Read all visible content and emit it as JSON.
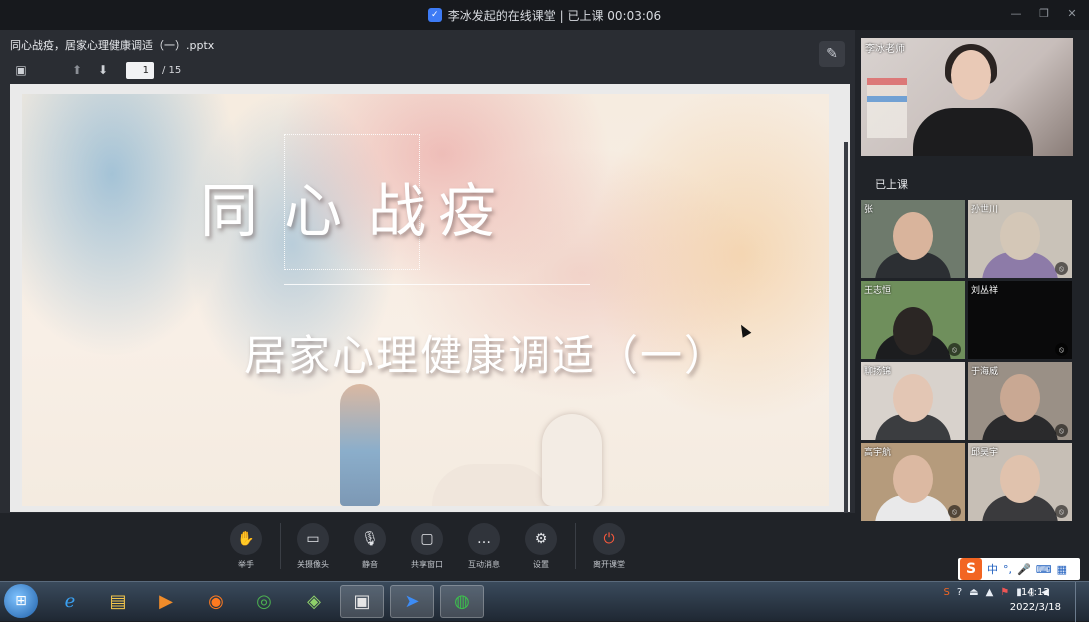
{
  "window": {
    "title": "李冰发起的在线课堂 | 已上课 00:03:06"
  },
  "document": {
    "filename": "同心战疫，居家心理健康调适（一）.pptx",
    "current_page": "1",
    "total_pages": "/ 15"
  },
  "slide": {
    "title_part1": "同",
    "title_part2": "心",
    "title_part3": "战疫",
    "subtitle": "居家心理健康调适（一）"
  },
  "controls": [
    {
      "label": "举手",
      "icon": "hand-icon"
    },
    {
      "label": "关摄像头",
      "icon": "camera-icon"
    },
    {
      "label": "静音",
      "icon": "microphone-icon"
    },
    {
      "label": "共享窗口",
      "icon": "share-screen-icon"
    },
    {
      "label": "互动消息",
      "icon": "chat-icon"
    },
    {
      "label": "设置",
      "icon": "gear-icon"
    },
    {
      "label": "离开课堂",
      "icon": "power-icon"
    }
  ],
  "sidebar": {
    "teacher_name": "李冰老师",
    "status": "已上课",
    "students": [
      {
        "name": "张"
      },
      {
        "name": "孙世川"
      },
      {
        "name": "王志恒"
      },
      {
        "name": "刘丛祥"
      },
      {
        "name": "聊扬锦"
      },
      {
        "name": "于海威"
      },
      {
        "name": "高宇航"
      },
      {
        "name": "邱昊宇"
      }
    ]
  },
  "ime": {
    "mode": "中",
    "punct": "°,"
  },
  "taskbar": {
    "time": "14:12",
    "date": "2022/3/18"
  },
  "colors": {
    "accent": "#3d7bf5",
    "leave": "#ff5a3c",
    "ime_brand": "#f26522"
  }
}
